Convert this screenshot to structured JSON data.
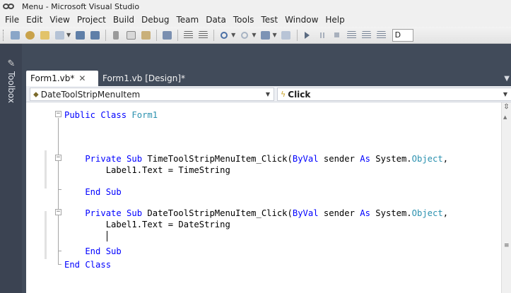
{
  "window": {
    "title": "Menu - Microsoft Visual Studio"
  },
  "menubar": {
    "items": [
      "File",
      "Edit",
      "View",
      "Project",
      "Build",
      "Debug",
      "Team",
      "Data",
      "Tools",
      "Test",
      "Window",
      "Help"
    ]
  },
  "toolbar": {
    "config_value": "D"
  },
  "toolbox": {
    "label": "Toolbox"
  },
  "tabs": [
    {
      "label": "Form1.vb*",
      "active": true
    },
    {
      "label": "Form1.vb [Design]*",
      "active": false
    }
  ],
  "navbar": {
    "class_combo": "DateToolStripMenuItem",
    "method_combo": "Click"
  },
  "code": {
    "lines": [
      "Public Class Form1",
      "",
      "    Private Sub TimeToolStripMenuItem_Click(ByVal sender As System.Object,",
      "        Label1.Text = TimeString",
      "",
      "    End Sub",
      "",
      "    Private Sub DateToolStripMenuItem_Click(ByVal sender As System.Object,",
      "        Label1.Text = DateString",
      "",
      "    End Sub",
      "End Class"
    ]
  },
  "colors": {
    "keyword": "#0000ff",
    "type": "#2b91af",
    "shell_background": "#414b5a"
  }
}
